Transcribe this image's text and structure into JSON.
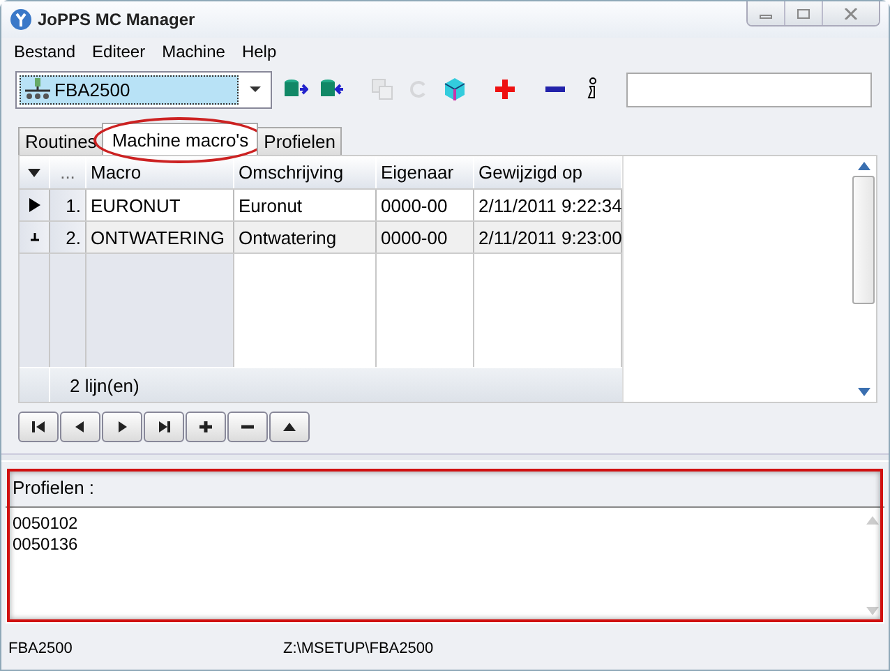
{
  "window": {
    "title": "JoPPS MC Manager"
  },
  "menu": [
    "Bestand",
    "Editeer",
    "Machine",
    "Help"
  ],
  "machine_select": {
    "value": "FBA2500"
  },
  "toolbar": [
    {
      "kind": "db-out",
      "disabled": false
    },
    {
      "kind": "db-in",
      "disabled": false
    },
    {
      "kind": "copy",
      "disabled": true
    },
    {
      "kind": "refresh",
      "disabled": true
    },
    {
      "kind": "cube",
      "disabled": false
    },
    {
      "kind": "plus",
      "disabled": false
    },
    {
      "kind": "minus",
      "disabled": false
    },
    {
      "kind": "info",
      "disabled": false
    }
  ],
  "tabs": [
    {
      "label": "Routines",
      "selected": false
    },
    {
      "label": "Machine macro's",
      "selected": true
    },
    {
      "label": "Profielen",
      "selected": false
    }
  ],
  "table": {
    "columns": [
      "...",
      "Macro",
      "Omschrijving",
      "Eigenaar",
      "Gewijzigd op"
    ],
    "rows": [
      {
        "kind": "current",
        "cells": [
          "1.",
          "EURONUT",
          "Euronut",
          "0000-00",
          "2/11/2011 9:22:34"
        ]
      },
      {
        "kind": "insert",
        "cells": [
          "2.",
          "ONTWATERING",
          "Ontwatering",
          "0000-00",
          "2/11/2011 9:23:00"
        ]
      }
    ],
    "footer": "2 lijn(en)"
  },
  "nav_buttons": [
    {
      "kind": "first"
    },
    {
      "kind": "prev"
    },
    {
      "kind": "next"
    },
    {
      "kind": "last"
    },
    {
      "kind": "add"
    },
    {
      "kind": "remove"
    },
    {
      "kind": "up"
    }
  ],
  "profiles": {
    "title": "Profielen :",
    "lines": [
      "0050102",
      "0050136"
    ]
  },
  "status_bar": [
    "FBA2500",
    "Z:\\MSETUP\\FBA2500"
  ]
}
